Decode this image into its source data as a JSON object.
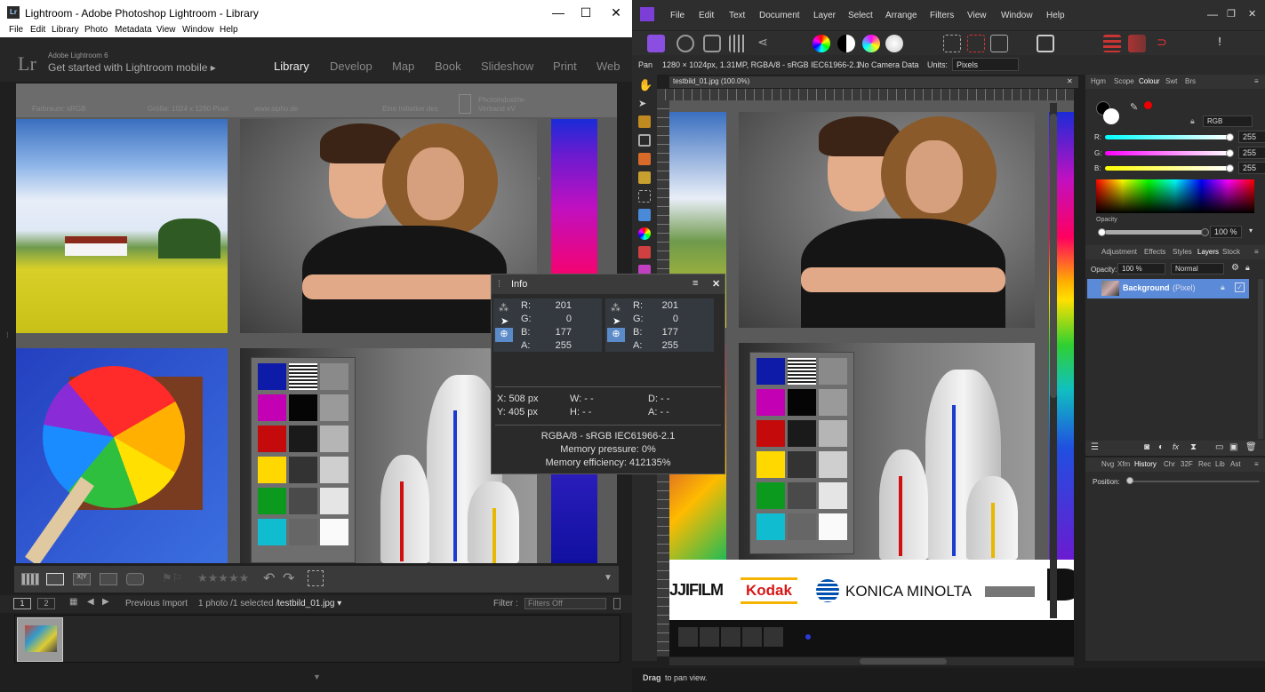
{
  "lightroom": {
    "title": "Lightroom - Adobe Photoshop Lightroom - Library",
    "icon": "Lr",
    "window_controls": [
      "—",
      "☐",
      "✕"
    ],
    "menu": [
      "File",
      "Edit",
      "Library",
      "Photo",
      "Metadata",
      "View",
      "Window",
      "Help"
    ],
    "identity": {
      "logo": "Lr",
      "version": "Adobe Lightroom 6",
      "mobile": "Get started with Lightroom mobile ▸"
    },
    "modules": [
      "Library",
      "Develop",
      "Map",
      "Book",
      "Slideshow",
      "Print",
      "Web"
    ],
    "active_module": "Library",
    "image_header": {
      "left": "Farbraum: sRGB",
      "mid": "Größe: 1024 x 1280 Pixel",
      "site": "www.sipho.de",
      "initiative": "Eine Initiative des",
      "org1": "Photoindustrie-",
      "org2": "Verband eV"
    },
    "toolbar": {
      "stars": "★★★★★"
    },
    "filmstrip": {
      "page1": "1",
      "page2": "2",
      "source": "Previous Import",
      "count": "1 photo /1 selected /",
      "filename": "testbild_01.jpg ▾",
      "filter_label": "Filter :",
      "filter_value": "Filters Off"
    }
  },
  "info": {
    "title": "Info",
    "left": {
      "R": "201",
      "G": "0",
      "B": "177",
      "A": "255"
    },
    "right": {
      "R": "201",
      "G": "0",
      "B": "177",
      "A": "255"
    },
    "labels": {
      "R": "R:",
      "G": "G:",
      "B": "B:",
      "A": "A:"
    },
    "x": "X: 508 px",
    "y": "Y: 405 px",
    "w": "W:  - -",
    "h": "H:  - -",
    "d": "D:  - -",
    "a": "A:  - -",
    "profile": "RGBA/8 - sRGB IEC61966-2.1",
    "mem_pressure": "Memory pressure: 0%",
    "mem_eff": "Memory efficiency: 412135%"
  },
  "affinity": {
    "menu": [
      "File",
      "Edit",
      "Text",
      "Document",
      "Layer",
      "Select",
      "Arrange",
      "Filters",
      "View",
      "Window",
      "Help"
    ],
    "context": {
      "tool": "Pan",
      "doc": "1280 × 1024px, 1.31MP, RGBA/8 - sRGB IEC61966-2.1",
      "camera": "No Camera Data",
      "units_label": "Units:",
      "units": "Pixels"
    },
    "tab": "testbild_01.jpg (100.0%)",
    "logos": {
      "fuji": "JJIFILM",
      "kodak": "Kodak",
      "konica": "KONICA MINOLTA"
    },
    "status": {
      "bold": "Drag",
      "rest": " to pan view."
    },
    "colour_tabs": [
      "Hgm",
      "Scope",
      "Colour",
      "Swt",
      "Brs"
    ],
    "colour_active": "Colour",
    "rgb_mode": "RGB",
    "r_label": "R:",
    "g_label": "G:",
    "b_label": "B:",
    "r": "255",
    "g": "255",
    "b": "255",
    "opacity_label": "Opacity",
    "opacity": "100 %",
    "layer_tabs": [
      "Adjustment",
      "Effects",
      "Styles",
      "Layers",
      "Stock"
    ],
    "layer_active": "Layers",
    "layer_opacity_label": "Opacity:",
    "layer_opacity": "100 %",
    "blend": "Normal",
    "layer_name": "Background",
    "layer_type": "(Pixel)",
    "history_tabs": [
      "Nvg",
      "Xfm",
      "History",
      "Chr",
      "32F",
      "Rec",
      "Lib",
      "Ast"
    ],
    "history_active": "History",
    "position_label": "Position:"
  }
}
